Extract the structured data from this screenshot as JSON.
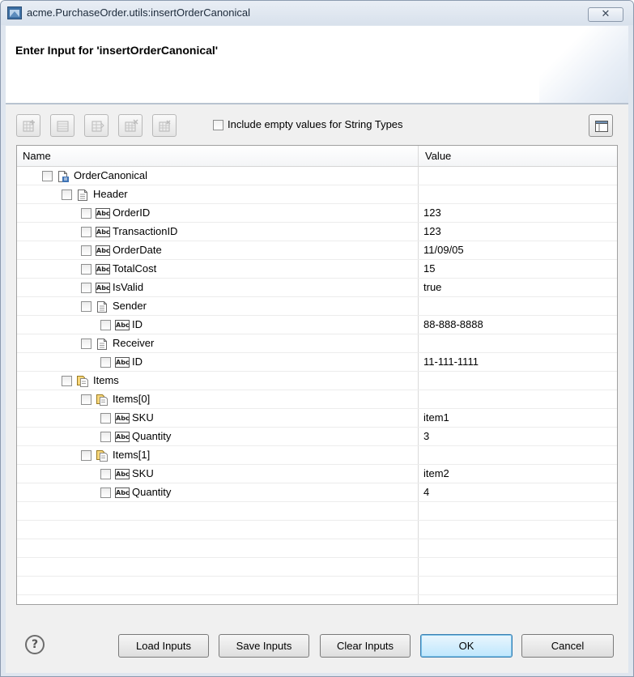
{
  "window": {
    "title": "acme.PurchaseOrder.utils:insertOrderCanonical",
    "close_label": "✕"
  },
  "header": {
    "heading": "Enter Input for 'insertOrderCanonical'"
  },
  "toolbar": {
    "include_empty_label": "Include empty values for String Types",
    "include_empty_checked": false
  },
  "tree": {
    "columns": {
      "name": "Name",
      "value": "Value"
    },
    "rows": [
      {
        "label": "OrderCanonical",
        "value": "",
        "icon": "document-record-icon"
      },
      {
        "label": "Header",
        "value": "",
        "icon": "document-icon"
      },
      {
        "label": "OrderID",
        "value": "123",
        "icon": "string-abc-icon"
      },
      {
        "label": "TransactionID",
        "value": "123",
        "icon": "string-abc-icon"
      },
      {
        "label": "OrderDate",
        "value": "11/09/05",
        "icon": "string-abc-icon"
      },
      {
        "label": "TotalCost",
        "value": "15",
        "icon": "string-abc-icon"
      },
      {
        "label": "IsValid",
        "value": "true",
        "icon": "string-abc-icon"
      },
      {
        "label": "Sender",
        "value": "",
        "icon": "document-icon"
      },
      {
        "label": "ID",
        "value": "88-888-8888",
        "icon": "string-abc-icon"
      },
      {
        "label": "Receiver",
        "value": "",
        "icon": "document-icon"
      },
      {
        "label": "ID",
        "value": "11-111-1111",
        "icon": "string-abc-icon"
      },
      {
        "label": "Items",
        "value": "",
        "icon": "document-list-icon"
      },
      {
        "label": "Items[0]",
        "value": "",
        "icon": "document-list-icon"
      },
      {
        "label": "SKU",
        "value": "item1",
        "icon": "string-abc-icon"
      },
      {
        "label": "Quantity",
        "value": "3",
        "icon": "string-abc-icon"
      },
      {
        "label": "Items[1]",
        "value": "",
        "icon": "document-list-icon"
      },
      {
        "label": "SKU",
        "value": "item2",
        "icon": "string-abc-icon"
      },
      {
        "label": "Quantity",
        "value": "4",
        "icon": "string-abc-icon"
      }
    ],
    "abc_text": "Abc"
  },
  "buttons": {
    "help": "?",
    "load": "Load Inputs",
    "save": "Save Inputs",
    "clear": "Clear Inputs",
    "ok": "OK",
    "cancel": "Cancel"
  }
}
